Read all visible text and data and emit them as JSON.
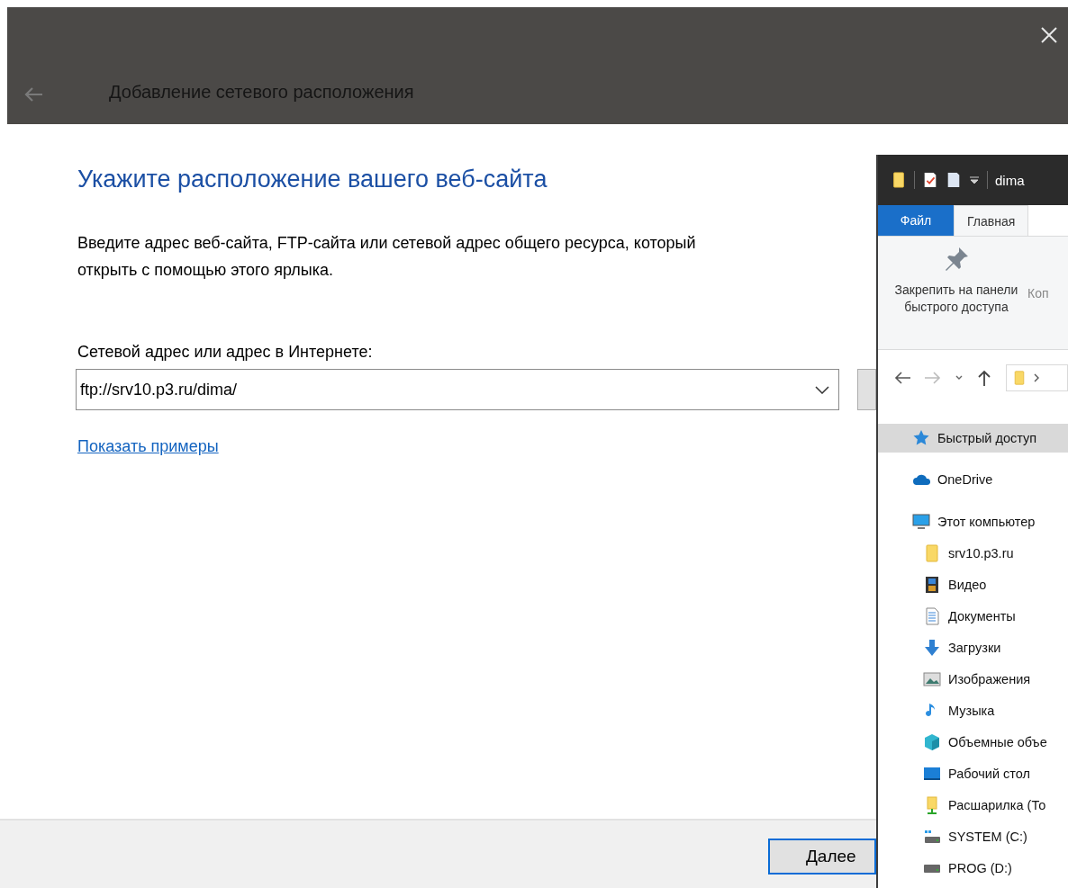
{
  "dialog": {
    "title": "Добавление сетевого расположения",
    "heading": "Укажите расположение вашего веб-сайта",
    "description_lines": [
      "Введите адрес веб-сайта, FTP-сайта или сетевой адрес общего ресурса, который",
      "открыть с помощью этого ярлыка."
    ],
    "address_label": "Сетевой адрес или адрес в Интернете:",
    "address_value": "ftp://srv10.p3.ru/dima/",
    "examples_link": "Показать примеры",
    "next_button": "Далее"
  },
  "explorer": {
    "title": "dima",
    "ribbon_tabs": [
      {
        "label": "Файл",
        "kind": "file",
        "selected": false
      },
      {
        "label": "Главная",
        "kind": "tab",
        "selected": true
      }
    ],
    "ribbon_commands": [
      "Закрепить на панели быстрого доступа",
      "Коп"
    ],
    "nav_pane": [
      {
        "label": "Быстрый доступ",
        "kind": "star",
        "selected": true
      },
      {
        "label": "OneDrive",
        "kind": "cloud",
        "selected": false
      },
      {
        "label": "Этот компьютер",
        "kind": "computer",
        "selected": false,
        "children": [
          {
            "label": "srv10.p3.ru",
            "kind": "folder",
            "selected": false
          },
          {
            "label": "Видео",
            "kind": "video",
            "selected": false
          },
          {
            "label": "Документы",
            "kind": "documents",
            "selected": false
          },
          {
            "label": "Загрузки",
            "kind": "downloads",
            "selected": false
          },
          {
            "label": "Изображения",
            "kind": "pictures",
            "selected": false
          },
          {
            "label": "Музыка",
            "kind": "music",
            "selected": false
          },
          {
            "label": "Объемные объе",
            "kind": "cube",
            "selected": false
          },
          {
            "label": "Рабочий стол",
            "kind": "desktop",
            "selected": false
          },
          {
            "label": "Расшарилка (То",
            "kind": "share",
            "selected": false
          },
          {
            "label": "SYSTEM (C:)",
            "kind": "systemdrive",
            "selected": false
          },
          {
            "label": "PROG (D:)",
            "kind": "drive",
            "selected": false
          }
        ]
      }
    ]
  }
}
